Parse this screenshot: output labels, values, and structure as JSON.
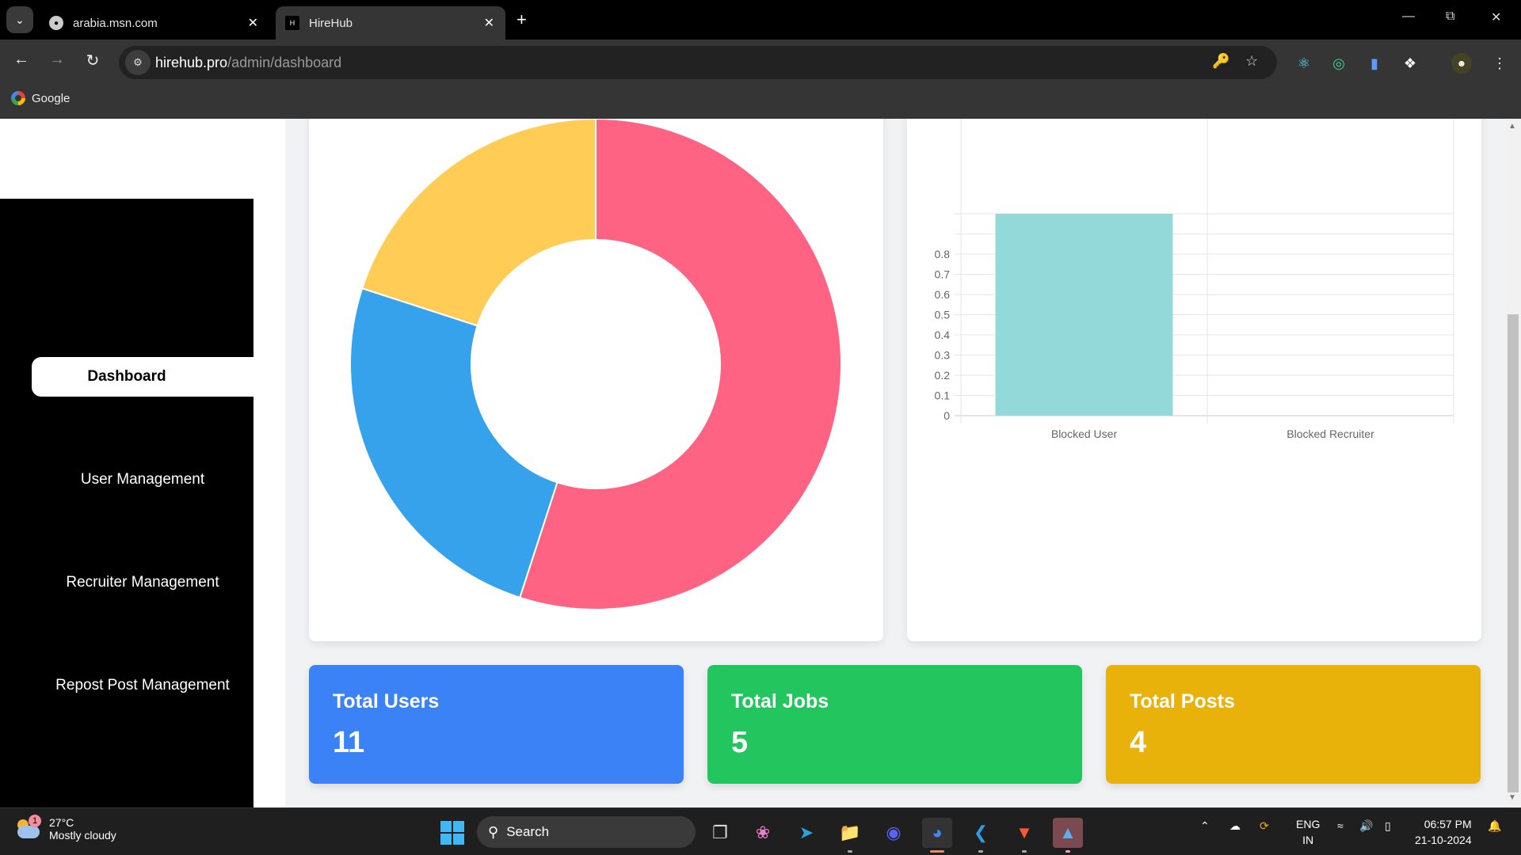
{
  "browser": {
    "tabs": [
      {
        "title": "arabia.msn.com",
        "active": false,
        "icon": "globe-icon"
      },
      {
        "title": "HireHub",
        "active": true,
        "icon": "hirehub-favicon"
      }
    ],
    "url": {
      "host": "hirehub.pro",
      "path": "/admin/dashboard"
    },
    "bookmarks": [
      {
        "label": "Google",
        "icon": "google-icon"
      }
    ],
    "toolbar_icons": [
      "key-icon",
      "star-icon",
      "react-devtools-icon",
      "extension-target-icon",
      "extension-phone-icon",
      "extensions-puzzle-icon",
      "profile-avatar",
      "menu-dots-icon"
    ]
  },
  "sidebar": {
    "items": [
      {
        "label": "Dashboard",
        "active": true
      },
      {
        "label": "User Management",
        "active": false
      },
      {
        "label": "Recruiter Management",
        "active": false
      },
      {
        "label": "Repost Post Management",
        "active": false
      }
    ]
  },
  "stats": [
    {
      "label": "Total Users",
      "value": "11",
      "color": "#3b82f6"
    },
    {
      "label": "Total Jobs",
      "value": "5",
      "color": "#22c55e"
    },
    {
      "label": "Total Posts",
      "value": "4",
      "color": "#e8b20b"
    }
  ],
  "chart_data": [
    {
      "type": "pie",
      "variant": "doughnut",
      "title": "",
      "categories": [
        "Total Users",
        "Total Jobs",
        "Total Posts"
      ],
      "values": [
        11,
        5,
        4
      ],
      "colors": [
        "#ff6384",
        "#36a2eb",
        "#ffcd56"
      ],
      "legend": "none"
    },
    {
      "type": "bar",
      "title": "",
      "categories": [
        "Blocked User",
        "Blocked Recruiter"
      ],
      "values": [
        1,
        0
      ],
      "colors": [
        "#94d9d9",
        "#94d9d9"
      ],
      "yticks_visible": [
        "0",
        "0.1",
        "0.2",
        "0.3",
        "0.4",
        "0.5",
        "0.6",
        "0.7",
        "0.8"
      ],
      "ylim": [
        0,
        1
      ],
      "grid": true,
      "xlabel": "",
      "ylabel": ""
    }
  ],
  "taskbar": {
    "weather": {
      "temp": "27°C",
      "condition": "Mostly cloudy",
      "badge": "1"
    },
    "search_label": "Search",
    "apps": [
      "task-view",
      "copilot",
      "telegram",
      "file-explorer",
      "discord",
      "chrome",
      "vscode",
      "brave",
      "photos"
    ],
    "lang": {
      "line1": "ENG",
      "line2": "IN"
    },
    "time": "06:57 PM",
    "date": "21-10-2024"
  }
}
